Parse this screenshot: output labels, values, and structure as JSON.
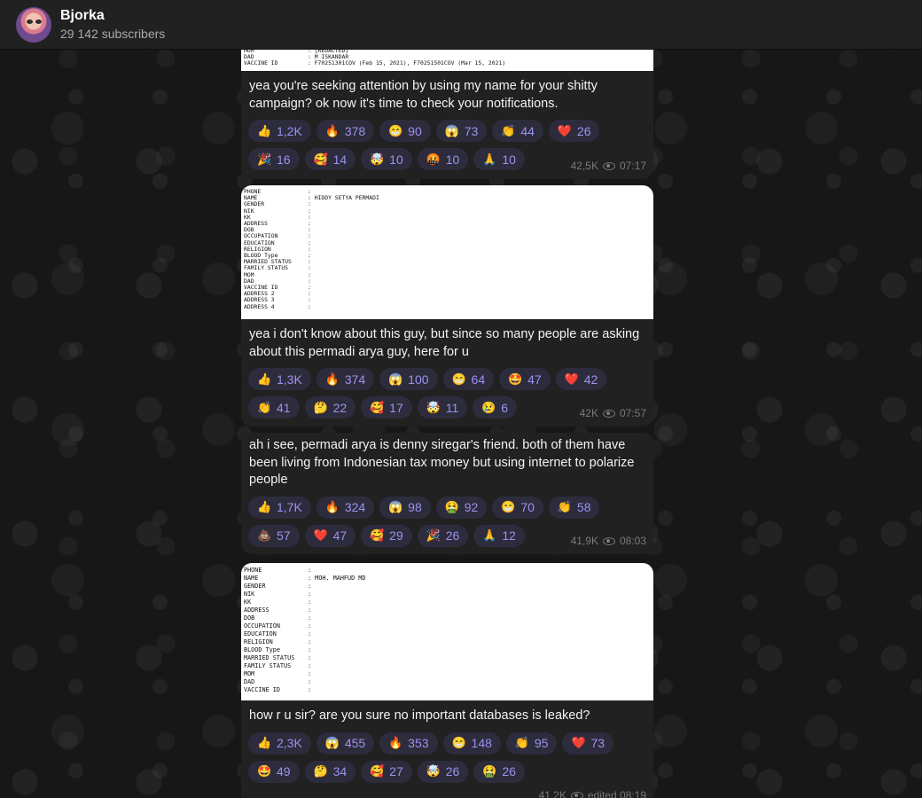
{
  "channel": {
    "name": "Bjorka",
    "subscribers": "29 142 subscribers"
  },
  "messages": [
    {
      "shot_rows": [
        {
          "k": "MOM",
          "v": ": [REDACTED]"
        },
        {
          "k": "DAD",
          "v": ": M ISKANDAR"
        },
        {
          "k": "VACCINE ID",
          "v": ": F70251301COV (Feb 15, 2021), F70251501COV (Mar 15, 2021)"
        }
      ],
      "text": "yea you're seeking attention by using my name for your shitty campaign? ok now it's time to check your notifications.",
      "reactions": [
        {
          "e": "👍",
          "c": "1,2K"
        },
        {
          "e": "🔥",
          "c": "378"
        },
        {
          "e": "😁",
          "c": "90"
        },
        {
          "e": "😱",
          "c": "73"
        },
        {
          "e": "👏",
          "c": "44"
        },
        {
          "e": "❤️",
          "c": "26"
        },
        {
          "e": "🎉",
          "c": "16"
        },
        {
          "e": "🥰",
          "c": "14"
        },
        {
          "e": "🤯",
          "c": "10"
        },
        {
          "e": "🤬",
          "c": "10"
        },
        {
          "e": "🙏",
          "c": "10"
        }
      ],
      "views": "42,5K",
      "time": "07:17"
    },
    {
      "shot_rows": [
        {
          "k": "PHONE",
          "v": ":"
        },
        {
          "k": "NAME",
          "v": ": HIDDY SETYA PERMADI"
        },
        {
          "k": "GENDER",
          "v": ":"
        },
        {
          "k": "NIK",
          "v": ":"
        },
        {
          "k": "KK",
          "v": ":"
        },
        {
          "k": "ADDRESS",
          "v": ":"
        },
        {
          "k": "DOB",
          "v": ":"
        },
        {
          "k": "OCCUPATION",
          "v": ":"
        },
        {
          "k": "EDUCATION",
          "v": ":"
        },
        {
          "k": "RELIGION",
          "v": ":"
        },
        {
          "k": "BLOOD Type",
          "v": ":"
        },
        {
          "k": "MARRIED STATUS",
          "v": ":"
        },
        {
          "k": "FAMILY STATUS",
          "v": ":"
        },
        {
          "k": "MOM",
          "v": ":"
        },
        {
          "k": "DAD",
          "v": ":"
        },
        {
          "k": "VACCINE ID",
          "v": ":"
        },
        {
          "k": "",
          "v": ""
        },
        {
          "k": "ADDRESS 2",
          "v": ":"
        },
        {
          "k": "ADDRESS 3",
          "v": ":"
        },
        {
          "k": "ADDRESS 4",
          "v": ":"
        }
      ],
      "text": "yea i don't know about this guy, but since so many people are asking about this permadi arya guy, here for u",
      "reactions": [
        {
          "e": "👍",
          "c": "1,3K"
        },
        {
          "e": "🔥",
          "c": "374"
        },
        {
          "e": "😱",
          "c": "100"
        },
        {
          "e": "😁",
          "c": "64"
        },
        {
          "e": "🤩",
          "c": "47"
        },
        {
          "e": "❤️",
          "c": "42"
        },
        {
          "e": "👏",
          "c": "41"
        },
        {
          "e": "🤔",
          "c": "22"
        },
        {
          "e": "🥰",
          "c": "17"
        },
        {
          "e": "🤯",
          "c": "11"
        },
        {
          "e": "😢",
          "c": "6"
        }
      ],
      "views": "42K",
      "time": "07:57"
    },
    {
      "text": "ah i see, permadi arya is denny siregar's friend. both of them have been living from Indonesian tax money but using internet to polarize people",
      "reactions": [
        {
          "e": "👍",
          "c": "1,7K"
        },
        {
          "e": "🔥",
          "c": "324"
        },
        {
          "e": "😱",
          "c": "98"
        },
        {
          "e": "🤮",
          "c": "92"
        },
        {
          "e": "😁",
          "c": "70"
        },
        {
          "e": "👏",
          "c": "58"
        },
        {
          "e": "💩",
          "c": "57"
        },
        {
          "e": "❤️",
          "c": "47"
        },
        {
          "e": "🥰",
          "c": "29"
        },
        {
          "e": "🎉",
          "c": "26"
        },
        {
          "e": "🙏",
          "c": "12"
        }
      ],
      "views": "41,9K",
      "time": "08:03"
    },
    {
      "shot_rows": [
        {
          "k": "PHONE",
          "v": ":"
        },
        {
          "k": "NAME",
          "v": ": MOH. MAHFUD MD"
        },
        {
          "k": "GENDER",
          "v": ":"
        },
        {
          "k": "NIK",
          "v": ":"
        },
        {
          "k": "KK",
          "v": ":"
        },
        {
          "k": "ADDRESS",
          "v": ":"
        },
        {
          "k": "DOB",
          "v": ":"
        },
        {
          "k": "OCCUPATION",
          "v": ":"
        },
        {
          "k": "EDUCATION",
          "v": ":"
        },
        {
          "k": "RELIGION",
          "v": ":"
        },
        {
          "k": "BLOOD Type",
          "v": ":"
        },
        {
          "k": "MARRIED STATUS",
          "v": ":"
        },
        {
          "k": "FAMILY STATUS",
          "v": ":"
        },
        {
          "k": "MOM",
          "v": ":"
        },
        {
          "k": "DAD",
          "v": ":"
        },
        {
          "k": "VACCINE ID",
          "v": ":"
        }
      ],
      "text": "how r u sir? are you sure no important databases is leaked?",
      "reactions": [
        {
          "e": "👍",
          "c": "2,3K"
        },
        {
          "e": "😱",
          "c": "455"
        },
        {
          "e": "🔥",
          "c": "353"
        },
        {
          "e": "😁",
          "c": "148"
        },
        {
          "e": "👏",
          "c": "95"
        },
        {
          "e": "❤️",
          "c": "73"
        },
        {
          "e": "🤩",
          "c": "49"
        },
        {
          "e": "🤔",
          "c": "34"
        },
        {
          "e": "🥰",
          "c": "27"
        },
        {
          "e": "🤯",
          "c": "26"
        },
        {
          "e": "🤮",
          "c": "26"
        }
      ],
      "views": "41,2K",
      "time": "edited 08:19"
    }
  ]
}
